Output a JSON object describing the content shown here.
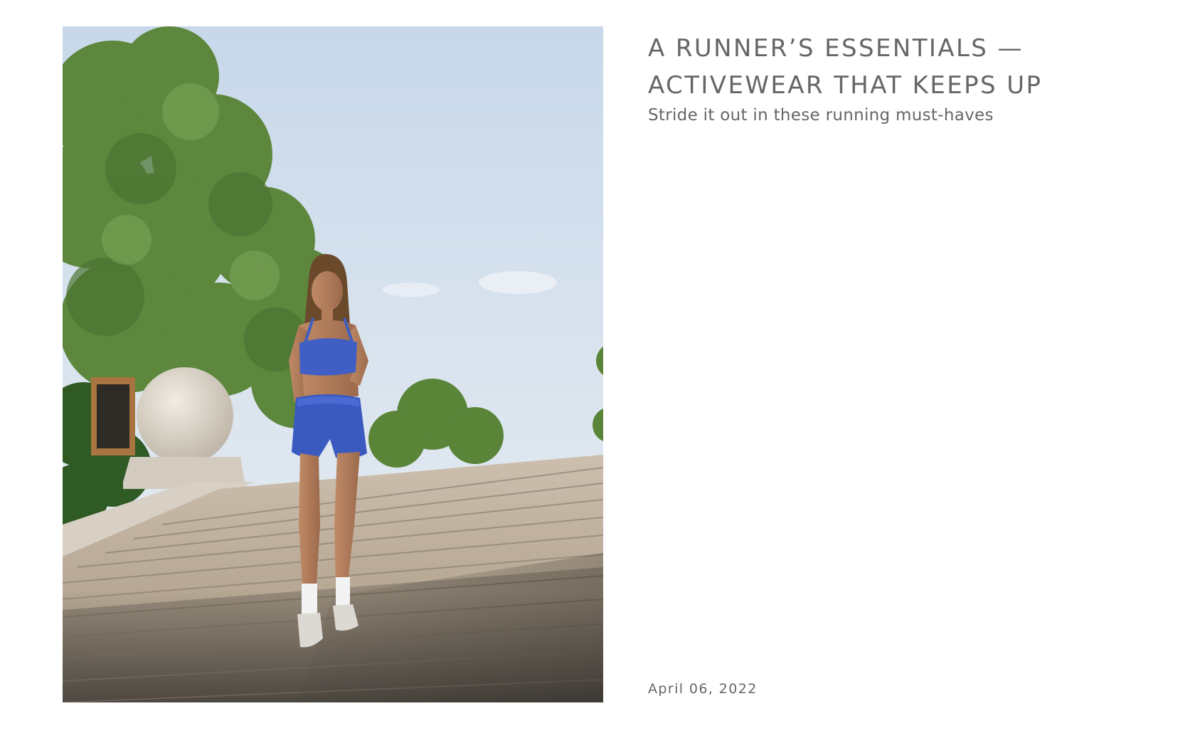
{
  "article": {
    "title_line_1": "A RUNNER’S ESSENTIALS —",
    "title_line_2": "ACTIVEWEAR THAT KEEPS UP",
    "subtitle": "Stride it out in these running must-haves",
    "date": "April 06, 2022"
  },
  "colors": {
    "text": "#666666",
    "background": "#ffffff",
    "sky": "#d9e4ef",
    "foliage": "#5f8a3e",
    "outfit": "#3f5fc4",
    "stone": "#b9ab98"
  }
}
